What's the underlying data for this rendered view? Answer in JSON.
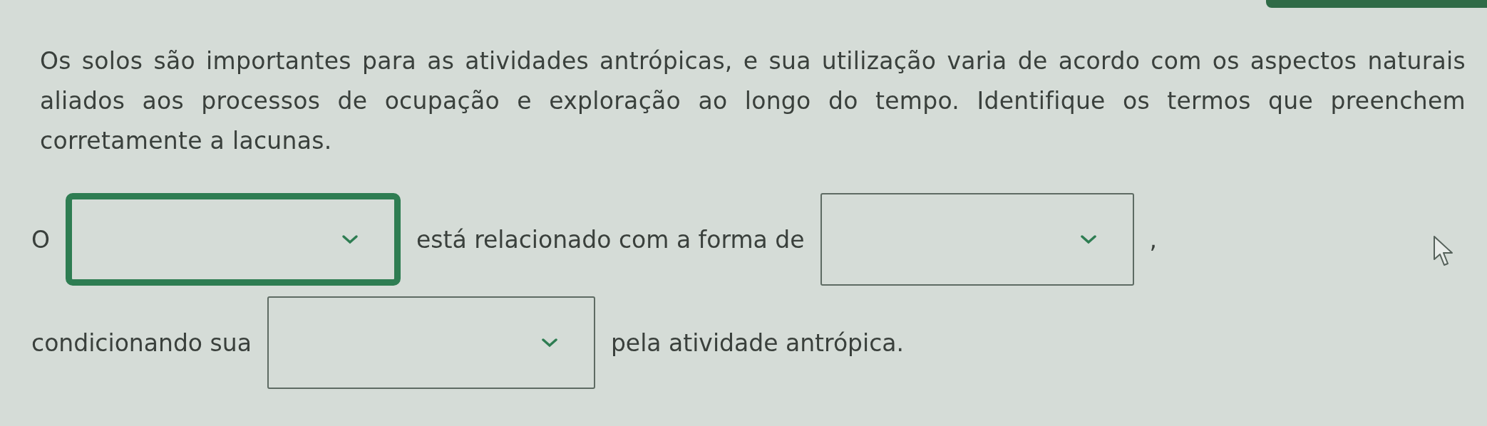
{
  "question": "Os solos são importantes para as atividades antrópicas, e sua utilização varia de acordo com os aspectos naturais aliados aos processos de ocupação e exploração ao longo do tempo. Identifique os termos que preenchem corretamente a lacunas.",
  "lines": [
    {
      "segments": [
        {
          "kind": "text",
          "text": "O"
        },
        {
          "kind": "dropdown",
          "focused": true
        },
        {
          "kind": "text",
          "text": "está relacionado com a forma de"
        },
        {
          "kind": "dropdown",
          "focused": false
        },
        {
          "kind": "text",
          "text": ","
        }
      ]
    },
    {
      "segments": [
        {
          "kind": "text",
          "text": "condicionando sua"
        },
        {
          "kind": "dropdown",
          "focused": false
        },
        {
          "kind": "text",
          "text": "pela atividade antrópica."
        }
      ]
    }
  ]
}
